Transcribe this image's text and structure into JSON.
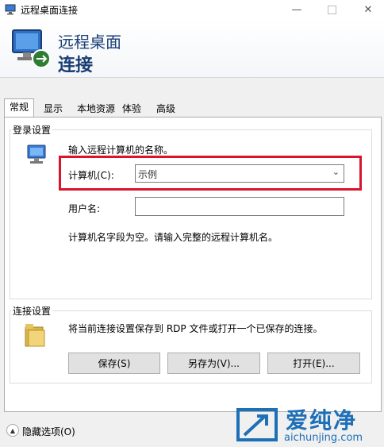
{
  "window": {
    "title": "远程桌面连接"
  },
  "banner": {
    "line1": "远程桌面",
    "line2": "连接"
  },
  "tabs": [
    {
      "label": "常规"
    },
    {
      "label": "显示"
    },
    {
      "label": "本地资源"
    },
    {
      "label": "体验"
    },
    {
      "label": "高级"
    }
  ],
  "login": {
    "group_label": "登录设置",
    "instruction": "输入远程计算机的名称。",
    "computer_label": "计算机(C):",
    "computer_value": "示例",
    "username_label": "用户名:",
    "username_value": "",
    "hint": "计算机名字段为空。请输入完整的远程计算机名。"
  },
  "connection": {
    "group_label": "连接设置",
    "description": "将当前连接设置保存到 RDP 文件或打开一个已保存的连接。",
    "save_label": "保存(S)",
    "save_as_label": "另存为(V)...",
    "open_label": "打开(E)..."
  },
  "footer": {
    "options_label": "隐藏选项(O)"
  },
  "watermark": {
    "brand": "爱纯净",
    "url": "aichunjing.com"
  },
  "colors": {
    "highlight": "#d8152c",
    "banner_text": "#1a3e74",
    "watermark": "#1d6fb8"
  }
}
